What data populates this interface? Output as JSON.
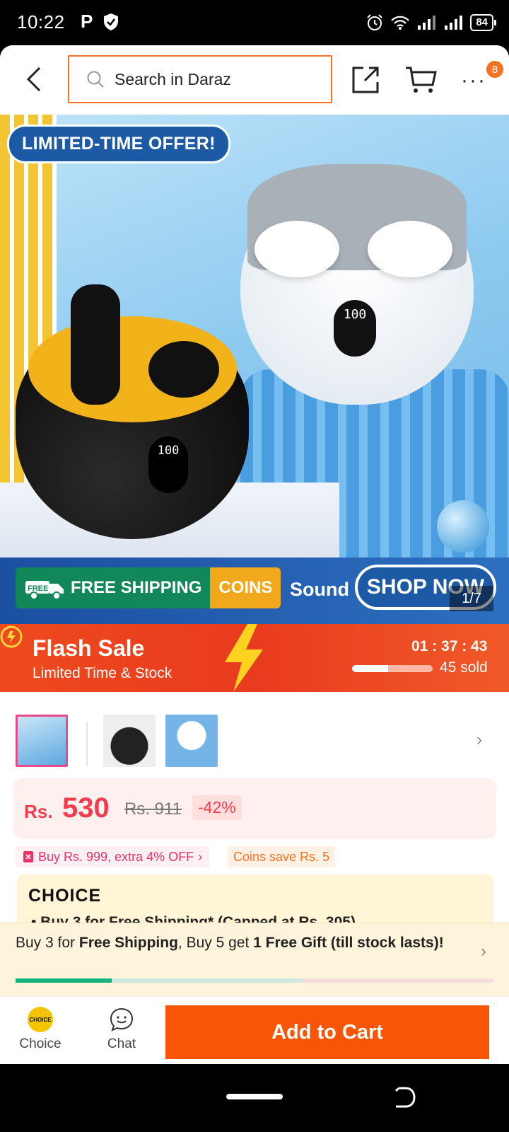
{
  "status_bar": {
    "time": "10:22",
    "p_icon": "P",
    "battery": "84"
  },
  "header": {
    "search_placeholder": "Search in Daraz",
    "menu_badge": "8"
  },
  "hero": {
    "promo_tag": "LIMITED-TIME OFFER!",
    "display_value": "100",
    "shipping_badge": "FREE SHIPPING",
    "shipping_free_mini": "FREE",
    "coins_badge": "COINS",
    "sound_text": "Sound",
    "shop_now": "SHOP NOW",
    "image_counter": "1/7"
  },
  "flash_sale": {
    "title": "Flash Sale",
    "subtitle": "Limited Time & Stock",
    "timer": "01 : 37 : 43",
    "sold": "45 sold",
    "sold_progress": 0.45
  },
  "price": {
    "currency": "Rs.",
    "current": "530",
    "original": "Rs. 911",
    "discount": "-42%"
  },
  "promos": {
    "voucher": "Buy Rs. 999, extra 4% OFF",
    "coins": "Coins save Rs. 5"
  },
  "choice": {
    "logo": "CHOICE",
    "bullet": "•  Buy 3 for  Free Shipping* (Capped at Rs. 305)"
  },
  "free_shipping_banner": {
    "part1": "Buy 3 for ",
    "bold1": "Free Shipping",
    "part2": ", Buy 5 get ",
    "bold2": "1 Free Gift (till stock lasts)!"
  },
  "bottom_bar": {
    "choice_icon_text": "CHOICE",
    "choice_label": "Choice",
    "chat_label": "Chat",
    "add_to_cart": "Add to Cart"
  },
  "colors": {
    "accent": "#f57224",
    "price": "#f23d4f",
    "add_to_cart": "#f85606",
    "flash": "#ee4a1e"
  }
}
